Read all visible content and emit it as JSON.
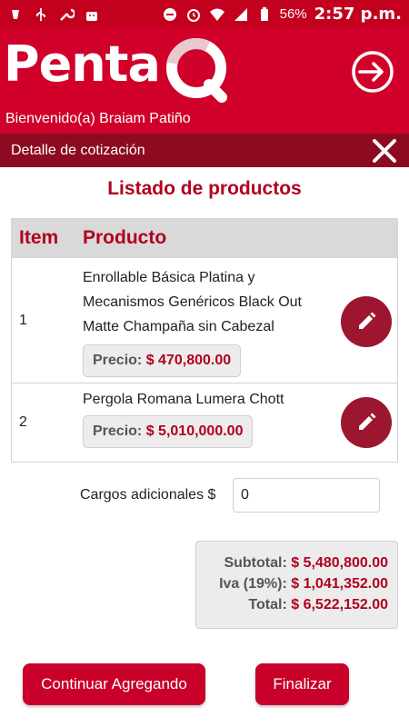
{
  "status_bar": {
    "battery": "56%",
    "time": "2:57 p.m."
  },
  "header": {
    "logo_text": "Penta",
    "logo_q": "Q",
    "welcome": "Bienvenido(a) Braiam Patiño"
  },
  "subheader": {
    "title": "Detalle de cotización"
  },
  "main": {
    "title": "Listado de productos",
    "columns": {
      "item": "Item",
      "product": "Producto"
    },
    "rows": [
      {
        "item": "1",
        "product": "Enrollable Básica Platina y Mecanismos Genéricos Black Out Matte Champaña sin Cabezal",
        "price_label": "Precio:",
        "price": "$ 470,800.00"
      },
      {
        "item": "2",
        "product": "Pergola Romana Lumera Chott",
        "price_label": "Precio:",
        "price": "$ 5,010,000.00"
      }
    ],
    "charges_label": "Cargos adicionales $",
    "charges_value": "0",
    "totals": {
      "subtotal_label": "Subtotal:",
      "subtotal": "$ 5,480,800.00",
      "iva_label": "Iva (19%):",
      "iva": "$ 1,041,352.00",
      "total_label": "Total:",
      "total": "$ 6,522,152.00"
    }
  },
  "buttons": {
    "continue": "Continuar Agregando",
    "finish": "Finalizar"
  },
  "colors": {
    "primary": "#d0002a",
    "dark": "#8d0a21",
    "accent_text": "#b0001e",
    "edit_button": "#9c1630"
  },
  "icons": [
    "usb-icon",
    "wrench-icon",
    "android-icon",
    "dnd-icon",
    "alarm-icon",
    "wifi-icon",
    "signal-icon",
    "battery-icon",
    "exit-icon",
    "close-icon",
    "pencil-icon"
  ]
}
